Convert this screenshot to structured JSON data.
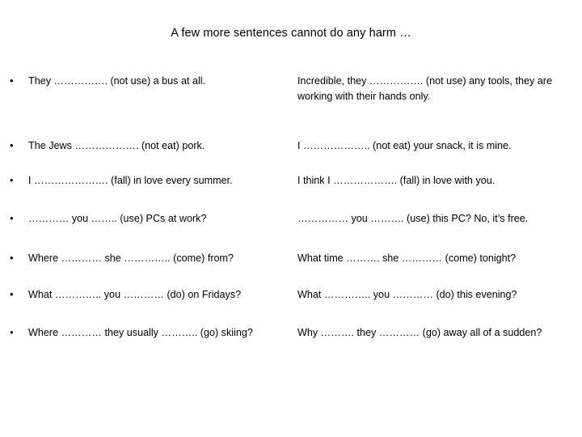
{
  "slide": {
    "title": "A few more sentences cannot do any harm …",
    "bullet_glyph": "•",
    "background_color": "#ffffff",
    "text_color": "#000000",
    "rows": [
      {
        "left": "They ……………. (not use) a bus at all.",
        "right": "Incredible, they ……………. (not use) any tools, they are working with their hands only."
      },
      {
        "left": "The Jews ………………. (not eat) pork.",
        "right": "I ……………….. (not eat) your snack, it is mine."
      },
      {
        "left": "I …………………. (fall) in love every summer.",
        "right": "I think I ………………. (fall) in love with you."
      },
      {
        "left": "………… you …….. (use) PCs at work?",
        "right": "…………… you ………. (use) this PC? No, it’s free."
      },
      {
        "left": "Where ………… she ………….. (come) from?",
        "right": "What time ………. she ………… (come) tonight?"
      },
      {
        "left": "What ………….. you ………… (do) on Fridays?",
        "right": "What ………….. you ………… (do) this evening?"
      },
      {
        "left": "Where ………… they usually ……….. (go) skiing?",
        "right": "Why ………. they ………… (go) away all of a sudden?"
      }
    ]
  }
}
